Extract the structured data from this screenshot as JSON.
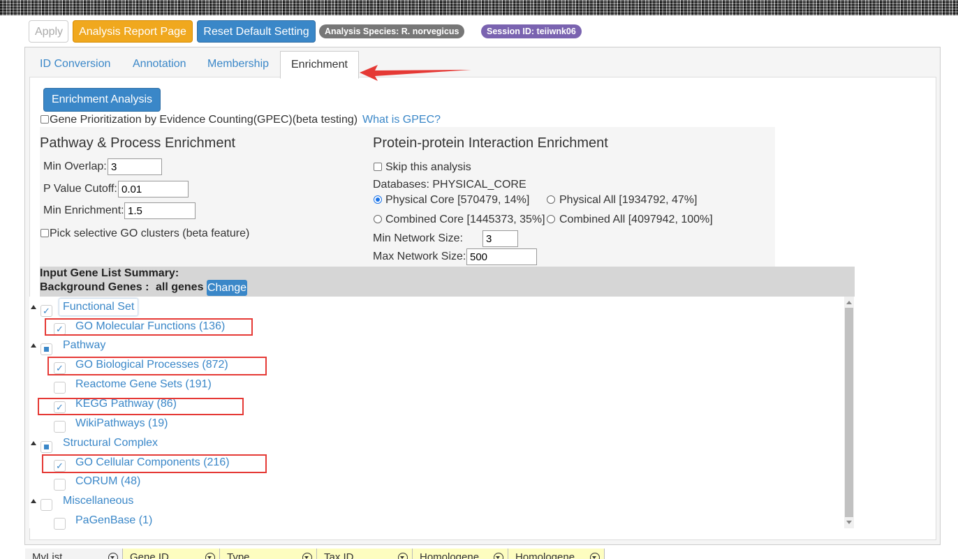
{
  "toolbar": {
    "apply_label": "Apply",
    "report_label": "Analysis Report Page",
    "reset_label": "Reset Default Setting",
    "species_badge": "Analysis Species: R. norvegicus",
    "session_badge": "Session ID: teiiwnk06"
  },
  "tabs": [
    {
      "label": "ID Conversion"
    },
    {
      "label": "Annotation"
    },
    {
      "label": "Membership"
    },
    {
      "label": "Enrichment",
      "active": true
    }
  ],
  "enrichment": {
    "run_button": "Enrichment Analysis",
    "gpec_label": "Gene Prioritization by Evidence Counting(GPEC)(beta testing)",
    "gpec_link": "What is GPEC?",
    "gpec_checked": false
  },
  "pathway": {
    "title": "Pathway & Process Enrichment",
    "min_overlap_label": "Min Overlap:",
    "min_overlap_value": "3",
    "pvalue_label": "P Value Cutoff:",
    "pvalue_value": "0.01",
    "min_enrichment_label": "Min Enrichment:",
    "min_enrichment_value": "1.5",
    "go_clusters_label": "Pick selective GO clusters (beta feature)"
  },
  "ppi": {
    "title": "Protein-protein Interaction Enrichment",
    "skip_label": "Skip this analysis",
    "databases_label": "Databases: PHYSICAL_CORE",
    "options": [
      {
        "label": "Physical Core [570479, 14%]",
        "selected": true
      },
      {
        "label": "Physical All [1934792, 47%]",
        "selected": false
      },
      {
        "label": "Combined Core [1445373, 35%]",
        "selected": false
      },
      {
        "label": "Combined All [4097942, 100%]",
        "selected": false
      }
    ],
    "min_network_label": "Min Network Size:",
    "min_network_value": "3",
    "max_network_label": "Max Network Size:",
    "max_network_value": "500"
  },
  "summary": {
    "title": "Input Gene List Summary:",
    "background_label": "Background Genes :",
    "background_value": "all genes",
    "change_label": "Change"
  },
  "tree": {
    "groups": [
      {
        "label": "Functional Set",
        "state": "checked",
        "children": [
          {
            "label": "GO Molecular Functions (136)",
            "checked": true
          }
        ]
      },
      {
        "label": "Pathway",
        "state": "partial",
        "children": [
          {
            "label": "GO Biological Processes (872)",
            "checked": true
          },
          {
            "label": "Reactome Gene Sets (191)",
            "checked": false
          },
          {
            "label": "KEGG Pathway (86)",
            "checked": true
          },
          {
            "label": "WikiPathways (19)",
            "checked": false
          }
        ]
      },
      {
        "label": "Structural Complex",
        "state": "partial",
        "children": [
          {
            "label": "GO Cellular Components (216)",
            "checked": true
          },
          {
            "label": "CORUM (48)",
            "checked": false
          }
        ]
      },
      {
        "label": "Miscellaneous",
        "state": "unchecked",
        "children": [
          {
            "label": "PaGenBase (1)",
            "checked": false
          }
        ]
      }
    ]
  },
  "grid": {
    "columns": [
      "MyList",
      "Gene ID",
      "Type",
      "Tax ID",
      "Homologene",
      "Homologene"
    ]
  },
  "colors": {
    "primary": "#3a87c8",
    "warning": "#f0a81e",
    "highlight_box": "#e53935",
    "session_badge": "#7a63b0",
    "species_badge": "#777777",
    "grid_header_yellow": "#fdfdc0"
  }
}
